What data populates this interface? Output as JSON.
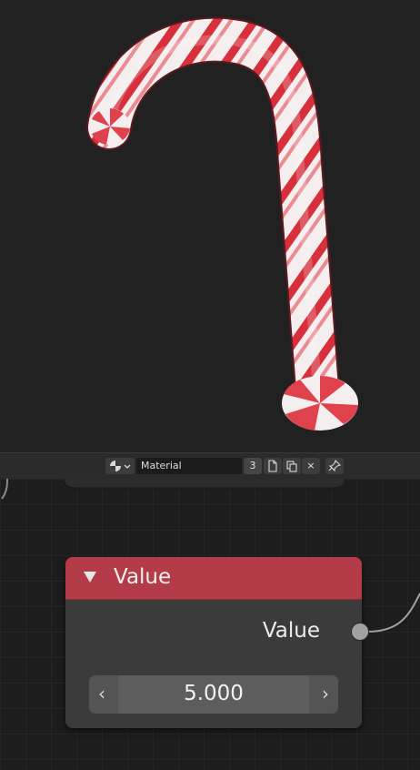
{
  "header": {
    "material_name": "Material",
    "user_count": "3",
    "unlink_symbol": "×",
    "icons": [
      "material-sphere-icon",
      "chevron-down-icon",
      "new-material-icon",
      "duplicate-material-icon",
      "unlink-icon",
      "pin-icon"
    ]
  },
  "node": {
    "title": "Value",
    "output_label": "Value",
    "value": "5.000",
    "header_color": "#b33c48",
    "decrement_symbol": "‹",
    "increment_symbol": "›"
  },
  "viewport": {
    "object": "candy-cane",
    "stripe_color": "#d9303c",
    "base_color": "#f2f2f2"
  }
}
